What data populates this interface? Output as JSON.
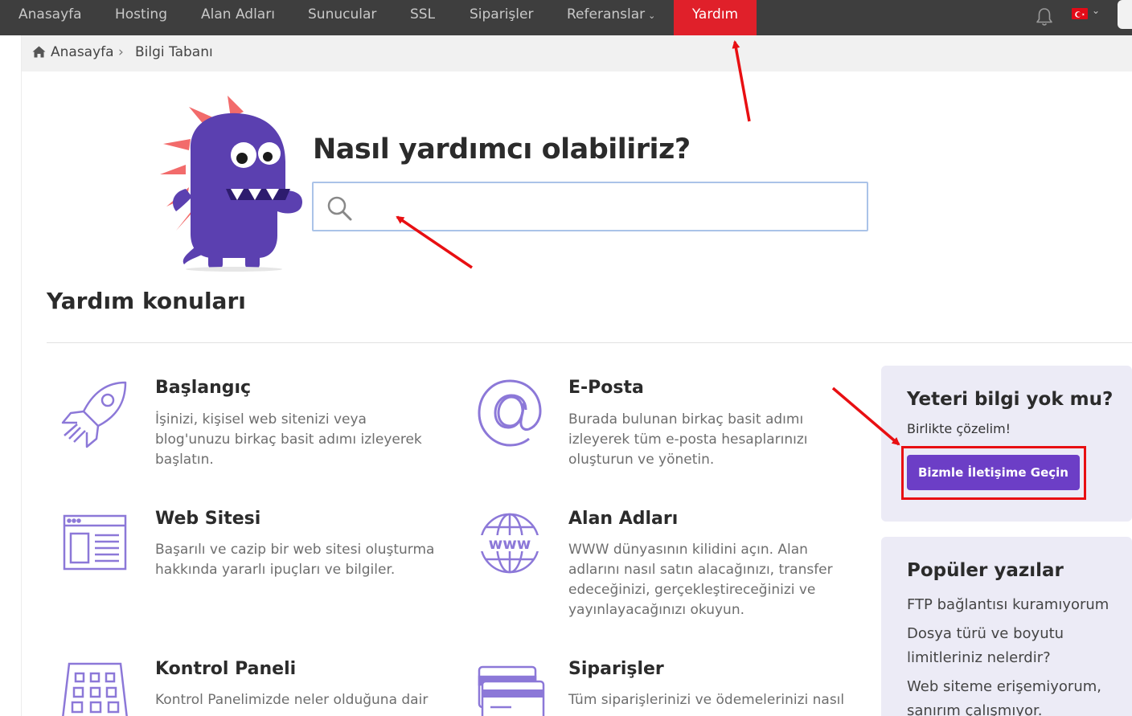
{
  "nav": {
    "items": [
      {
        "label": "Anasayfa"
      },
      {
        "label": "Hosting"
      },
      {
        "label": "Alan Adları"
      },
      {
        "label": "Sunucular"
      },
      {
        "label": "SSL"
      },
      {
        "label": "Siparişler"
      },
      {
        "label": "Referanslar"
      },
      {
        "label": "Yardım"
      }
    ],
    "active": "Yardım",
    "icons": [
      "bell-icon",
      "turkey-flag-icon",
      "chevron-down-icon"
    ]
  },
  "breadcrumb": {
    "home": "Anasayfa",
    "current": "Bilgi Tabanı"
  },
  "hero": {
    "title": "Nasıl yardımcı olabiliriz?",
    "search_value": "",
    "search_placeholder": ""
  },
  "topics": {
    "heading": "Yardım konuları",
    "items": [
      {
        "title": "Başlangıç",
        "desc": "İşinizi, kişisel web sitenizi veya blog'unuzu birkaç basit adımı izleyerek başlatın.",
        "icon": "rocket-icon"
      },
      {
        "title": "E-Posta",
        "desc": "Burada bulunan birkaç basit adımı izleyerek tüm e-posta hesaplarınızı oluşturun ve yönetin.",
        "icon": "at-sign-icon"
      },
      {
        "title": "Web Sitesi",
        "desc": "Başarılı ve cazip bir web sitesi oluşturma hakkında yararlı ipuçları ve bilgiler.",
        "icon": "website-layout-icon"
      },
      {
        "title": "Alan Adları",
        "desc": "WWW dünyasının kilidini açın. Alan adlarını nasıl satın alacağınızı, transfer edeceğinizi, gerçekleştireceğinizi ve yayınlayacağınızı okuyun.",
        "icon": "www-globe-icon"
      },
      {
        "title": "Kontrol Paneli",
        "desc": "Kontrol Panelimizde neler olduğuna dair",
        "icon": "control-panel-icon"
      },
      {
        "title": "Siparişler",
        "desc": "Tüm siparişlerinizi ve ödemelerinizi nasıl",
        "icon": "credit-card-icon"
      }
    ]
  },
  "sidebar": {
    "help_title": "Yeteri bilgi yok mu?",
    "help_sub": "Birlikte çözelim!",
    "contact_button": "Bizmle İletişime Geçin",
    "popular_title": "Popüler yazılar",
    "popular": [
      "FTP bağlantısı kuramıyorum",
      "Dosya türü ve boyutu limitleriniz nelerdir?",
      "Web siteme erişemiyorum, sanırım çalışmıyor."
    ]
  },
  "colors": {
    "nav_bg": "#3e3e3e",
    "active_red": "#e0202a",
    "accent_purple": "#6c3ec6",
    "icon_purple": "#8c78d8",
    "card_bg": "#ecebf6",
    "annotation_red": "#e80f12"
  }
}
